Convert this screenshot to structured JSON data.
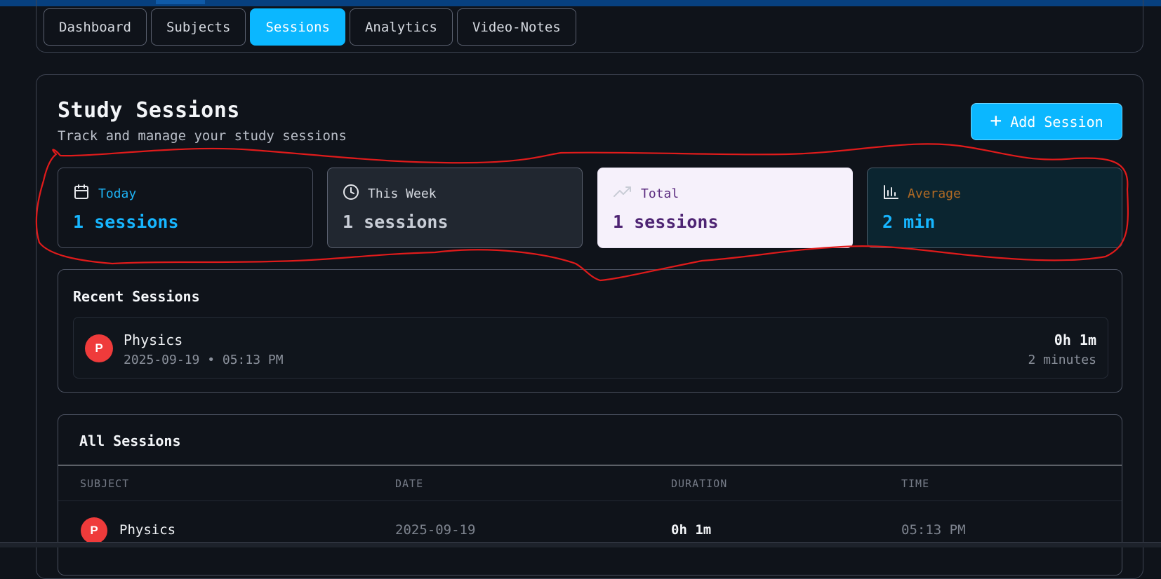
{
  "nav": {
    "tabs": [
      {
        "label": "Dashboard",
        "active": false
      },
      {
        "label": "Subjects",
        "active": false
      },
      {
        "label": "Sessions",
        "active": true
      },
      {
        "label": "Analytics",
        "active": false
      },
      {
        "label": "Video-Notes",
        "active": false
      }
    ]
  },
  "header": {
    "title": "Study Sessions",
    "subtitle": "Track and manage your study sessions",
    "add_button": "Add Session"
  },
  "stats": {
    "today": {
      "label": "Today",
      "value": "1 sessions",
      "icon": "calendar-icon"
    },
    "week": {
      "label": "This Week",
      "value": "1 sessions",
      "icon": "clock-icon"
    },
    "total": {
      "label": "Total",
      "value": "1 sessions",
      "icon": "trending-up-icon"
    },
    "average": {
      "label": "Average",
      "value": "2 min",
      "icon": "bar-chart-icon"
    }
  },
  "recent": {
    "heading": "Recent Sessions",
    "items": [
      {
        "avatar": "P",
        "subject": "Physics",
        "meta": "2025-09-19 • 05:13 PM",
        "duration": "0h 1m",
        "minutes": "2 minutes"
      }
    ]
  },
  "all_sessions": {
    "heading": "All Sessions",
    "columns": [
      "SUBJECT",
      "DATE",
      "DURATION",
      "TIME"
    ],
    "rows": [
      {
        "avatar": "P",
        "subject": "Physics",
        "date": "2025-09-19",
        "duration": "0h 1m",
        "time": "05:13 PM"
      }
    ]
  },
  "colors": {
    "accent": "#0bb7ff",
    "background": "#0f131a",
    "avatar": "#ef3b3b",
    "annotation": "#e01b1b"
  }
}
